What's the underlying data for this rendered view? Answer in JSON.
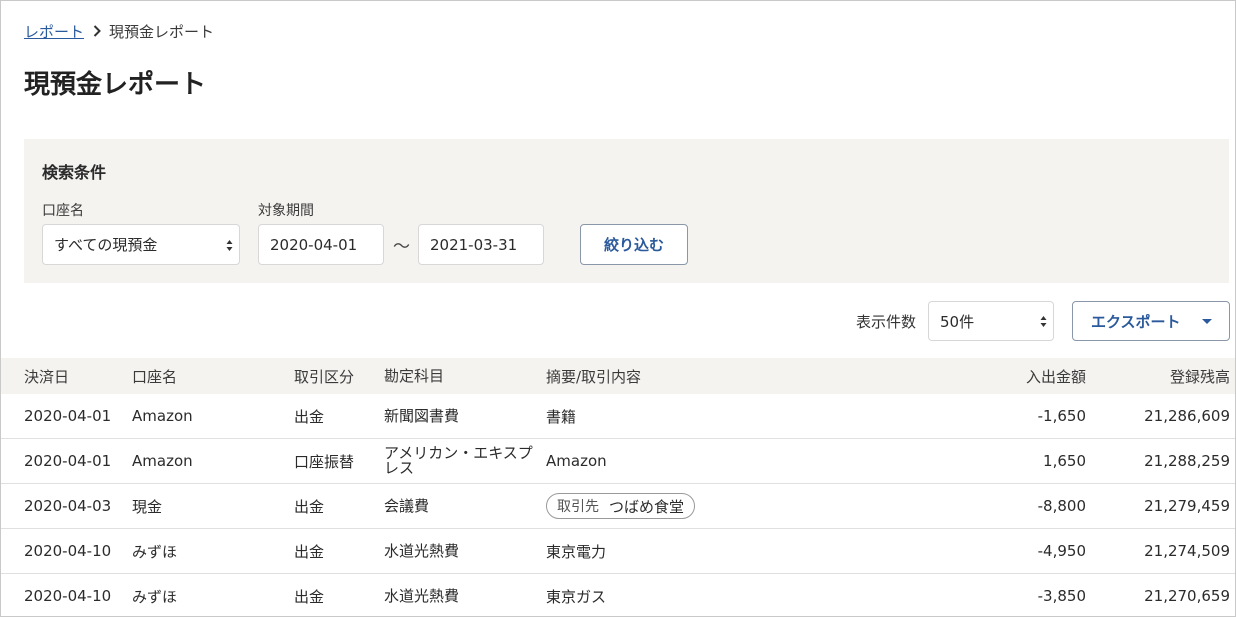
{
  "breadcrumb": {
    "parent": "レポート",
    "current": "現預金レポート"
  },
  "page_title": "現預金レポート",
  "search": {
    "title": "検索条件",
    "account_label": "口座名",
    "account_value": "すべての現預金",
    "period_label": "対象期間",
    "date_from": "2020-04-01",
    "date_separator": "〜",
    "date_to": "2021-03-31",
    "filter_button": "絞り込む"
  },
  "toolbar": {
    "per_page_label": "表示件数",
    "per_page_value": "50件",
    "export_button": "エクスポート"
  },
  "table": {
    "headers": [
      "決済日",
      "口座名",
      "取引区分",
      "勘定科目",
      "摘要/取引内容",
      "入出金額",
      "登録残高"
    ],
    "rows": [
      {
        "date": "2020-04-01",
        "account": "Amazon",
        "type": "出金",
        "subject": "新聞図書費",
        "memo": "書籍",
        "amount": "-1,650",
        "balance": "21,286,609"
      },
      {
        "date": "2020-04-01",
        "account": "Amazon",
        "type": "口座振替",
        "subject": "アメリカン・エキスプレス",
        "memo": "Amazon",
        "amount": "1,650",
        "balance": "21,288,259"
      },
      {
        "date": "2020-04-03",
        "account": "現金",
        "type": "出金",
        "subject": "会議費",
        "memo_tag_key": "取引先",
        "memo_tag_value": "つばめ食堂",
        "amount": "-8,800",
        "balance": "21,279,459"
      },
      {
        "date": "2020-04-10",
        "account": "みずほ",
        "type": "出金",
        "subject": "水道光熱費",
        "memo": "東京電力",
        "amount": "-4,950",
        "balance": "21,274,509"
      },
      {
        "date": "2020-04-10",
        "account": "みずほ",
        "type": "出金",
        "subject": "水道光熱費",
        "memo": "東京ガス",
        "amount": "-3,850",
        "balance": "21,270,659"
      }
    ]
  },
  "colors": {
    "link": "#2a5a9c",
    "panel_bg": "#f4f3f0",
    "border": "#d7d7d7"
  },
  "icons": {
    "breadcrumb_separator": "chevron-right-icon",
    "select_arrows": "updown-arrows-icon",
    "export_caret": "caret-down-icon"
  }
}
